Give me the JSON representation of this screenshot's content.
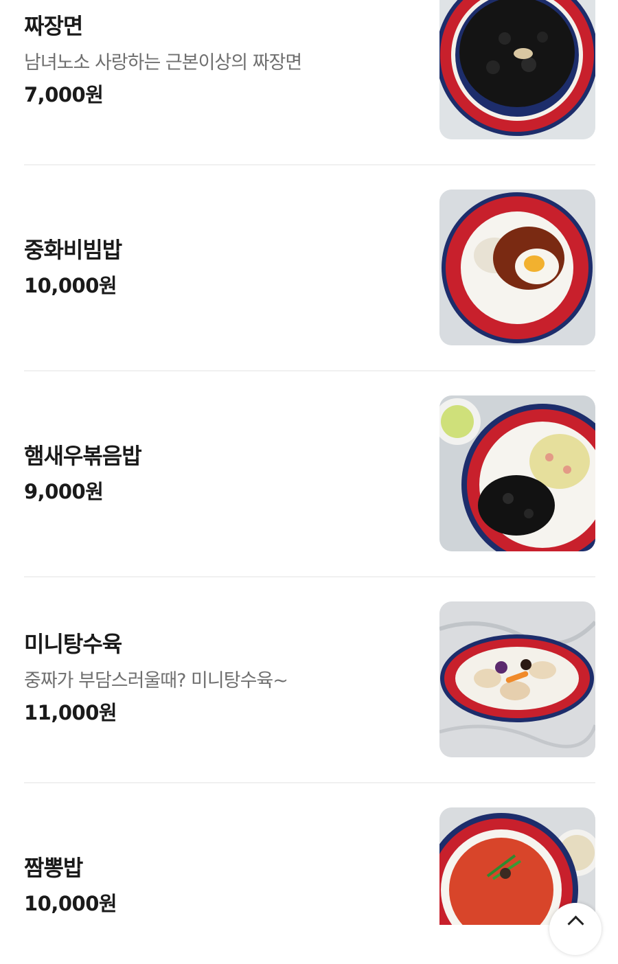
{
  "colors": {
    "title": "#1a1a1a",
    "description": "#6f6f6f",
    "divider": "#f0f0f0",
    "plate_rim": "#c8202c",
    "plate_edge": "#1d2d6b"
  },
  "menu": {
    "items": [
      {
        "name": "짜장면",
        "description": "남녀노소 사랑하는 근본이상의 짜장면",
        "price": "7,000원",
        "image_icon": "jjajangmyeon-photo"
      },
      {
        "name": "중화비빔밥",
        "description": "",
        "price": "10,000원",
        "image_icon": "bibimbap-photo"
      },
      {
        "name": "햄새우볶음밥",
        "description": "",
        "price": "9,000원",
        "image_icon": "fried-rice-photo"
      },
      {
        "name": "미니탕수육",
        "description": "중짜가 부담스러울때? 미니탕수육~",
        "price": "11,000원",
        "image_icon": "tangsuyuk-photo"
      },
      {
        "name": "짬뽕밥",
        "description": "",
        "price": "10,000원",
        "image_icon": "jjambbong-rice-photo"
      }
    ]
  },
  "scroll_top": {
    "icon": "chevron-up-icon"
  }
}
